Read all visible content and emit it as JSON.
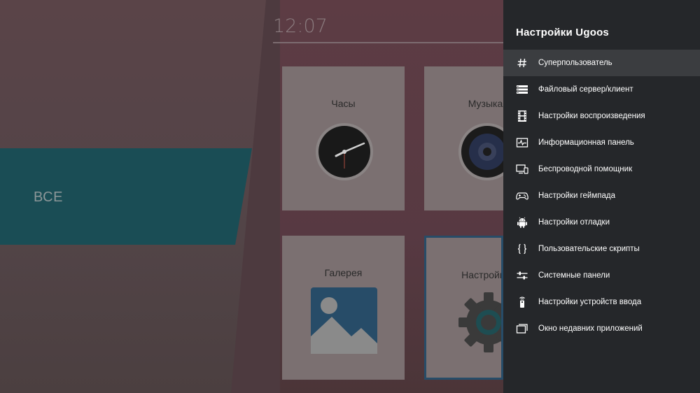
{
  "launcher": {
    "clock": "12:07",
    "category": "ВСЕ",
    "tiles": [
      {
        "label": "Часы"
      },
      {
        "label": "Музыка"
      },
      {
        "label": "Галерея"
      },
      {
        "label": "Настройки"
      }
    ]
  },
  "panel": {
    "title": "Настройки Ugoos",
    "items": [
      {
        "label": "Суперпользователь",
        "icon": "hash-icon"
      },
      {
        "label": "Файловый сервер/клиент",
        "icon": "server-icon"
      },
      {
        "label": "Настройки воспроизведения",
        "icon": "film-icon"
      },
      {
        "label": "Информационная панель",
        "icon": "pulse-monitor-icon"
      },
      {
        "label": "Беспроводной помощник",
        "icon": "devices-icon"
      },
      {
        "label": "Настройки геймпада",
        "icon": "gamepad-icon"
      },
      {
        "label": "Настройки отладки",
        "icon": "android-icon"
      },
      {
        "label": "Пользовательские скрипты",
        "icon": "braces-icon"
      },
      {
        "label": "Системные панели",
        "icon": "sliders-icon"
      },
      {
        "label": "Настройки устройств ввода",
        "icon": "remote-control-icon"
      },
      {
        "label": "Окно недавних приложений",
        "icon": "recent-windows-icon"
      }
    ]
  },
  "colors": {
    "panel_bg": "#25272a",
    "active_item_bg": "#3b3d40",
    "teal": "#1a4d55"
  }
}
